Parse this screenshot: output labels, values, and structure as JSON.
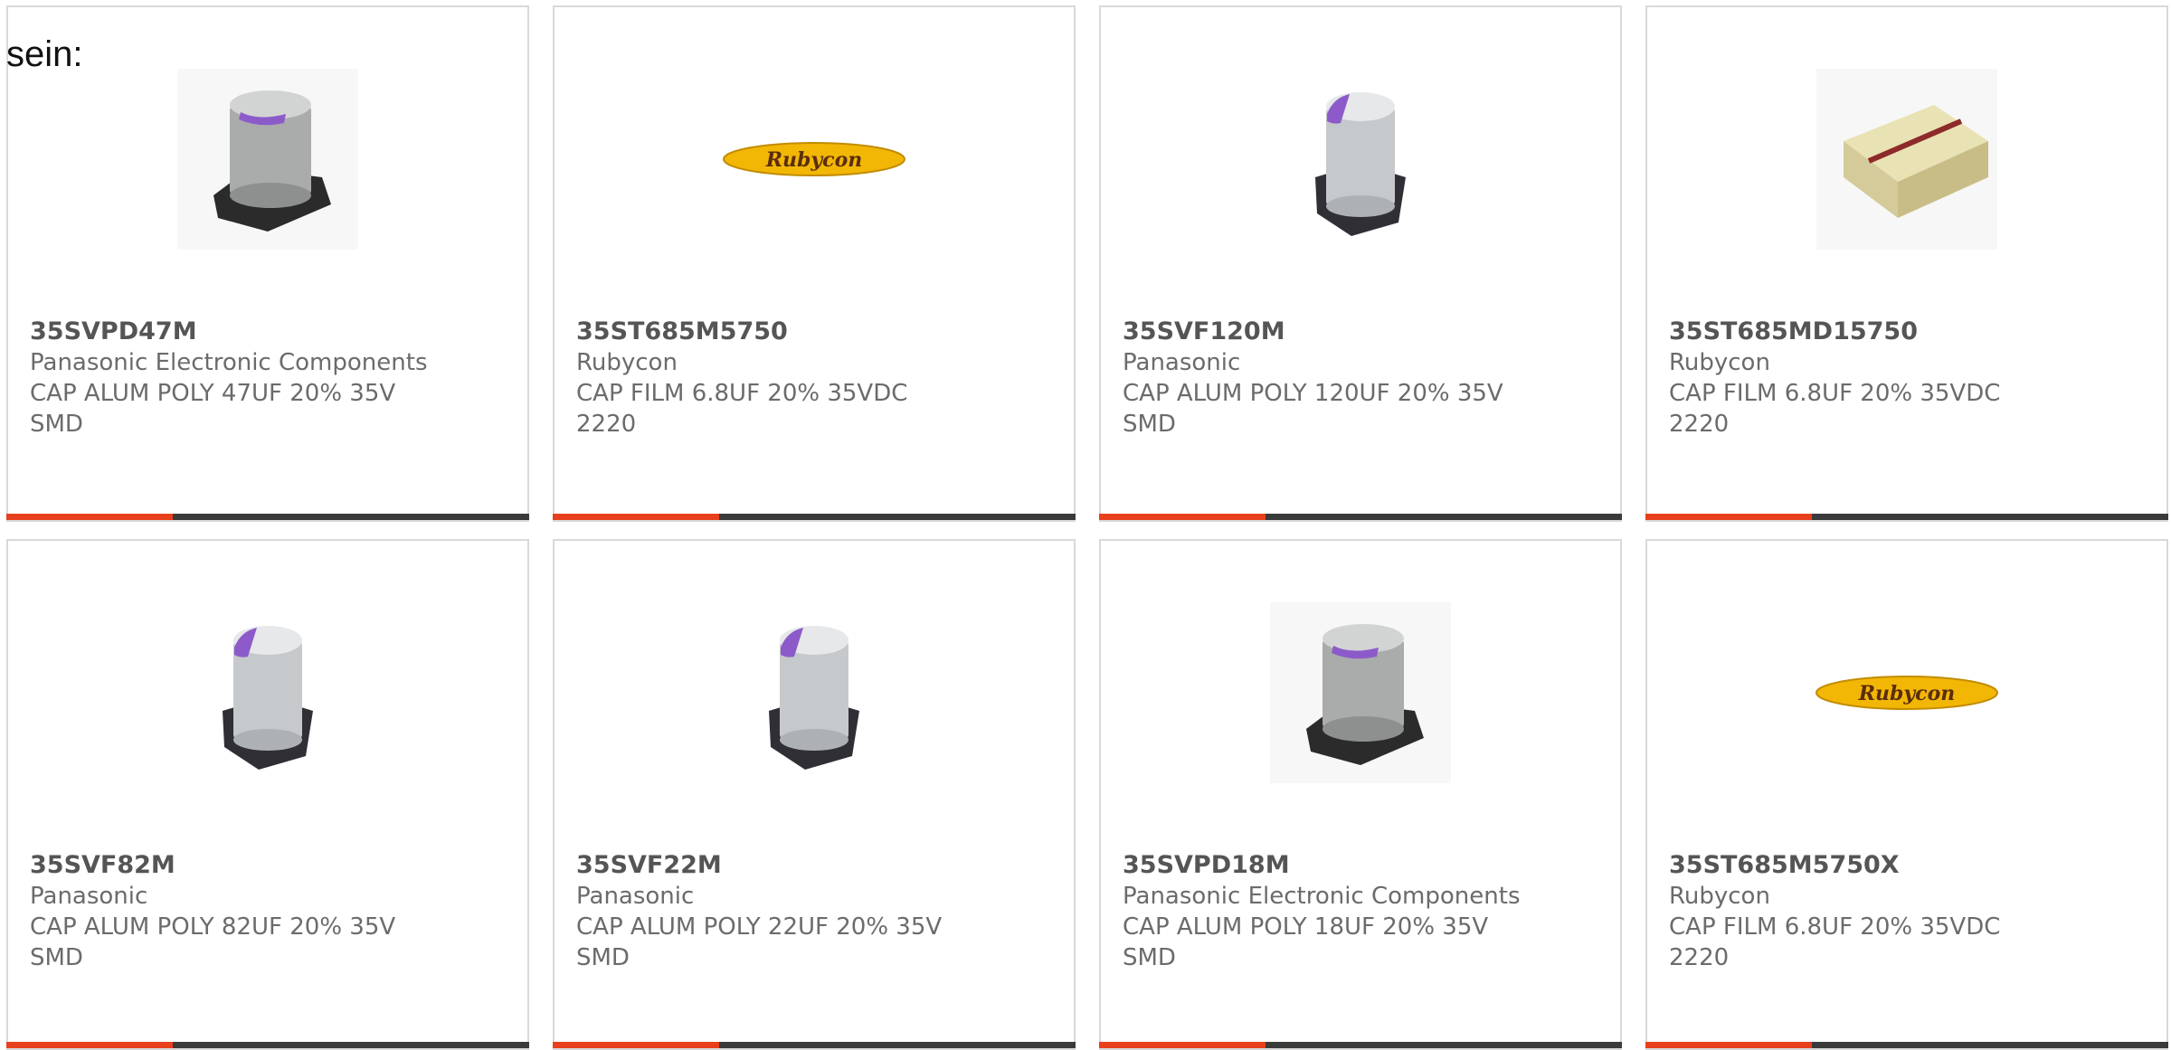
{
  "intro_text": "sein:",
  "colors": {
    "accent": "#e8401c",
    "bar": "#3a3a3a",
    "border": "#d9d9d9",
    "text": "#6b6b6b",
    "rubycon_logo": "#f2b705",
    "capacitor_stripe": "#8c5bc9"
  },
  "products": [
    {
      "part_number": "35SVPD47M",
      "manufacturer": "Panasonic Electronic Components",
      "description": "CAP ALUM POLY 47UF 20% 35V SMD",
      "image": "capacitor-dark-base-icon"
    },
    {
      "part_number": "35ST685M5750",
      "manufacturer": "Rubycon",
      "description": "CAP FILM 6.8UF 20% 35VDC 2220",
      "image": "rubycon-logo",
      "logo_text": "Rubycon"
    },
    {
      "part_number": "35SVF120M",
      "manufacturer": "Panasonic",
      "description": "CAP ALUM POLY 120UF 20% 35V SMD",
      "image": "capacitor-tall-icon"
    },
    {
      "part_number": "35ST685MD15750",
      "manufacturer": "Rubycon",
      "description": "CAP FILM 6.8UF 20% 35VDC 2220",
      "image": "film-capacitor-icon"
    },
    {
      "part_number": "35SVF82M",
      "manufacturer": "Panasonic",
      "description": "CAP ALUM POLY 82UF 20% 35V SMD",
      "image": "capacitor-tall-icon"
    },
    {
      "part_number": "35SVF22M",
      "manufacturer": "Panasonic",
      "description": "CAP ALUM POLY 22UF 20% 35V SMD",
      "image": "capacitor-tall-icon"
    },
    {
      "part_number": "35SVPD18M",
      "manufacturer": "Panasonic Electronic Components",
      "description": "CAP ALUM POLY 18UF 20% 35V SMD",
      "image": "capacitor-dark-base-icon"
    },
    {
      "part_number": "35ST685M5750X",
      "manufacturer": "Rubycon",
      "description": "CAP FILM 6.8UF 20% 35VDC 2220",
      "image": "rubycon-logo",
      "logo_text": "Rubycon"
    }
  ]
}
